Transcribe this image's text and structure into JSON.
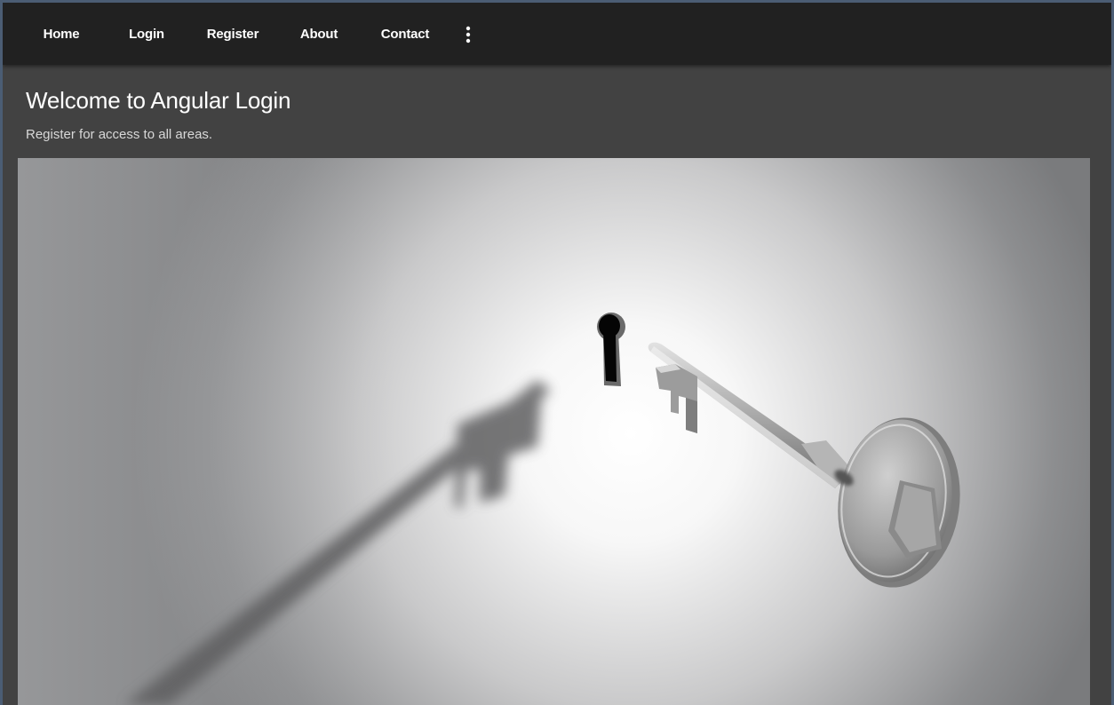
{
  "nav": {
    "items": [
      {
        "label": "Home"
      },
      {
        "label": "Login"
      },
      {
        "label": "Register"
      },
      {
        "label": "About"
      },
      {
        "label": "Contact"
      }
    ],
    "more_icon": "more-vert-icon"
  },
  "hero": {
    "title": "Welcome to Angular Login",
    "subtitle": "Register for access to all areas."
  },
  "image": {
    "subject": "key-and-keyhole"
  },
  "colors": {
    "toolbar_bg": "#212121",
    "page_bg": "#424242",
    "text": "#ffffff",
    "subtitle": "#d8d8d8"
  }
}
